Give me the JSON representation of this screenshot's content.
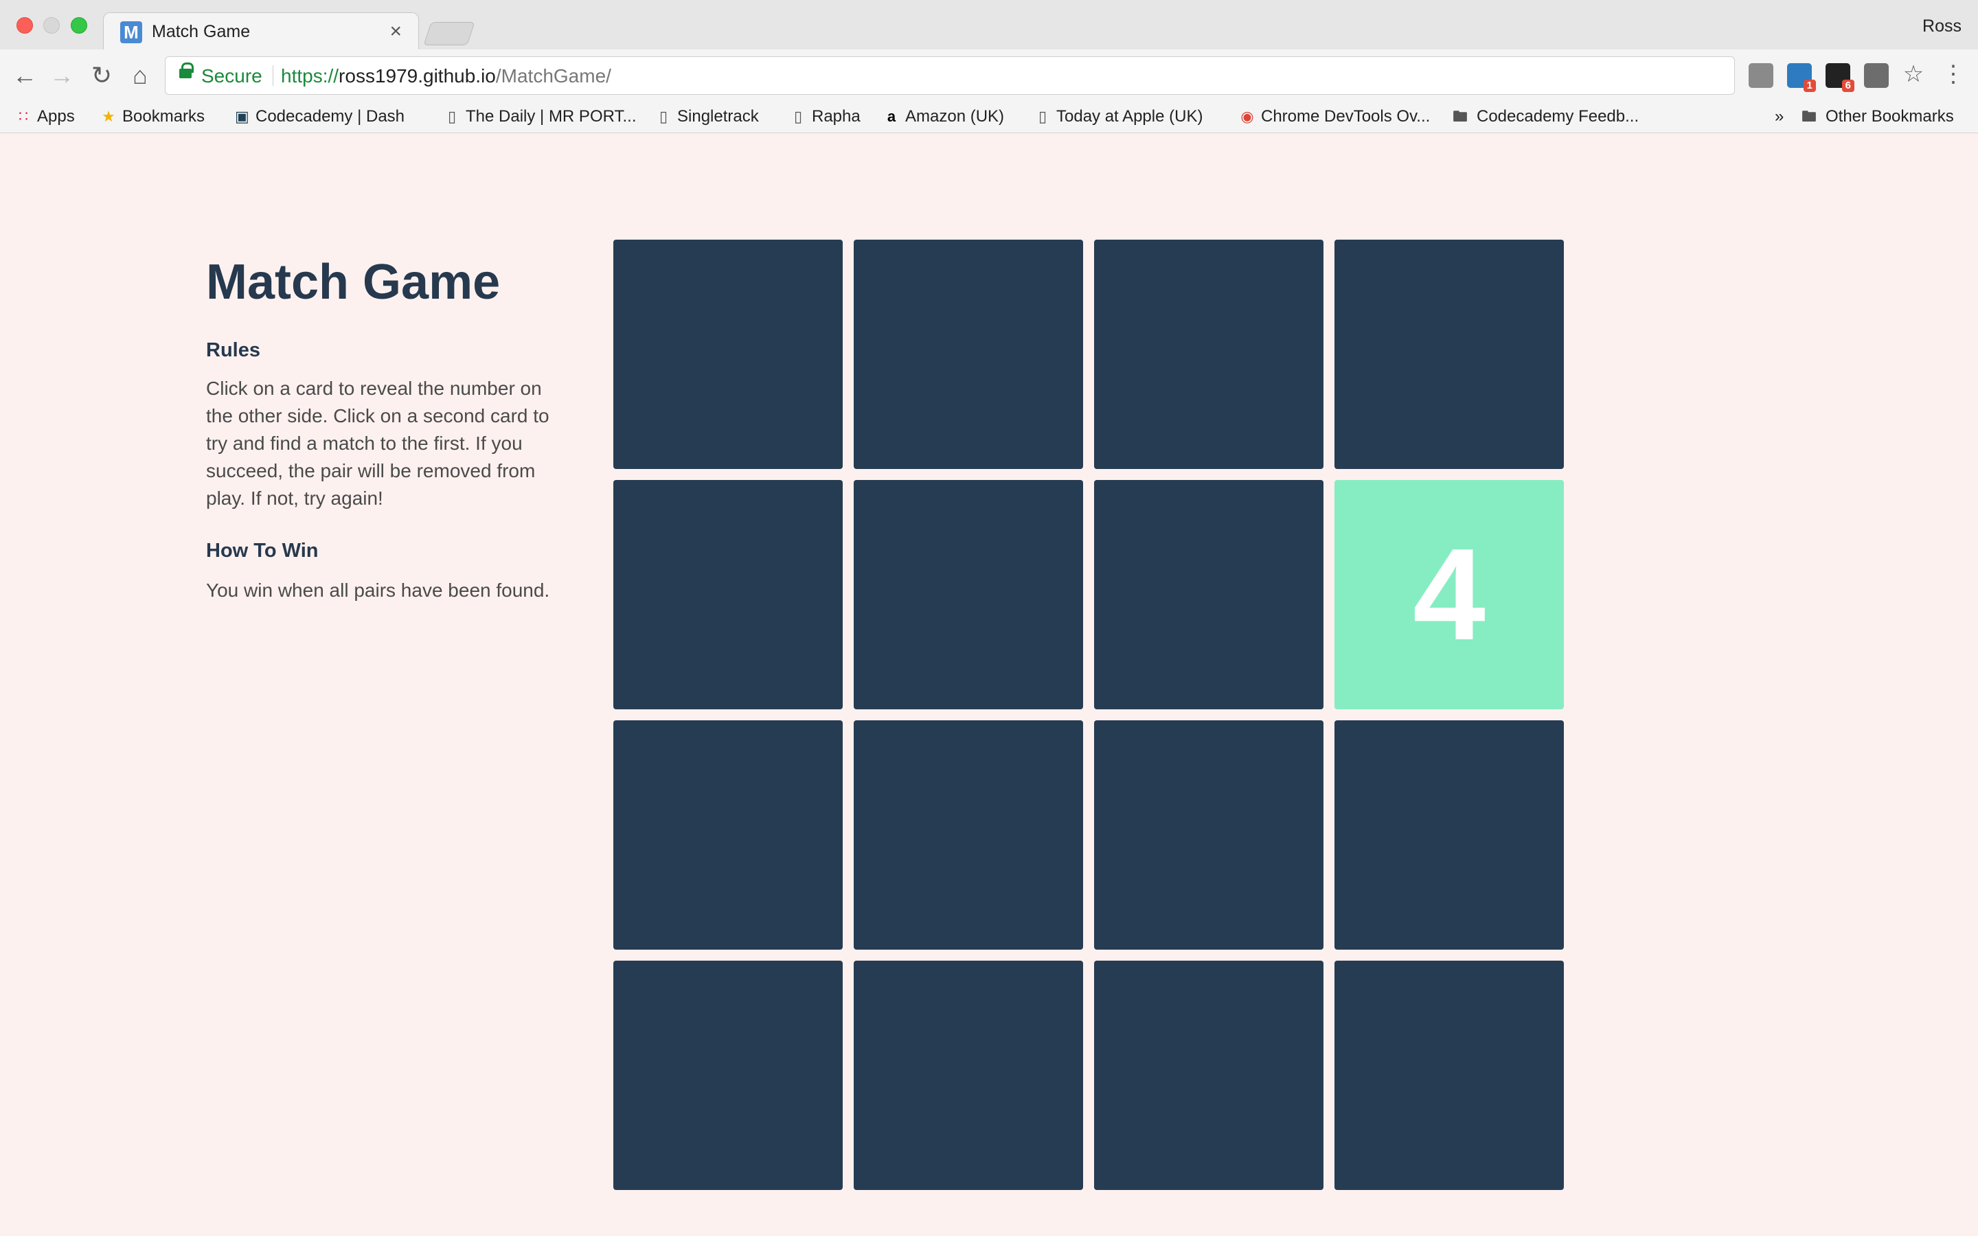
{
  "browser": {
    "tab_title": "Match Game",
    "tab_favicon_letter": "M",
    "tab_close": "×",
    "profile_name": "Ross",
    "secure_label": "Secure",
    "url_protocol": "https://",
    "url_host": "ross1979.github.io",
    "url_path": "/MatchGame/",
    "extensions": [
      {
        "name": "extension-icon",
        "badge": ""
      },
      {
        "name": "linkedin-icon",
        "badge": "1"
      },
      {
        "name": "amazon-assistant-icon",
        "badge": "6"
      },
      {
        "name": "lightbulb-icon",
        "badge": ""
      }
    ],
    "bookmarks": [
      {
        "label": "Apps",
        "icon": "apps-grid-icon"
      },
      {
        "label": "Bookmarks",
        "icon": "star-icon"
      },
      {
        "label": "Codecademy | Dash",
        "icon": "codecademy-icon"
      },
      {
        "label": "The Daily | MR PORT...",
        "icon": "page-icon"
      },
      {
        "label": "Singletrack",
        "icon": "page-icon"
      },
      {
        "label": "Rapha",
        "icon": "page-icon"
      },
      {
        "label": "Amazon (UK)",
        "icon": "amazon-icon"
      },
      {
        "label": "Today at Apple (UK)",
        "icon": "page-icon"
      },
      {
        "label": "Chrome DevTools Ov...",
        "icon": "chrome-icon"
      },
      {
        "label": "Codecademy Feedb...",
        "icon": "folder-icon"
      }
    ],
    "bookmarks_overflow": "»",
    "other_bookmarks": "Other Bookmarks"
  },
  "game": {
    "title": "Match Game",
    "rules_heading": "Rules",
    "rules_text": "Click on a card to reveal the number on the other side. Click on a second card to try and find a match to the first. If you succeed, the pair will be removed from play. If not, try again!",
    "win_heading": "How To Win",
    "win_text": "You win when all pairs have been found.",
    "colors": {
      "card_back": "#263c53",
      "card_flipped": "#86edc2",
      "background": "#fdf1ef"
    },
    "cards": [
      "",
      "",
      "",
      "",
      "",
      "",
      "",
      "4",
      "",
      "",
      "",
      "",
      "",
      "",
      "",
      ""
    ],
    "flipped_index": 7
  }
}
